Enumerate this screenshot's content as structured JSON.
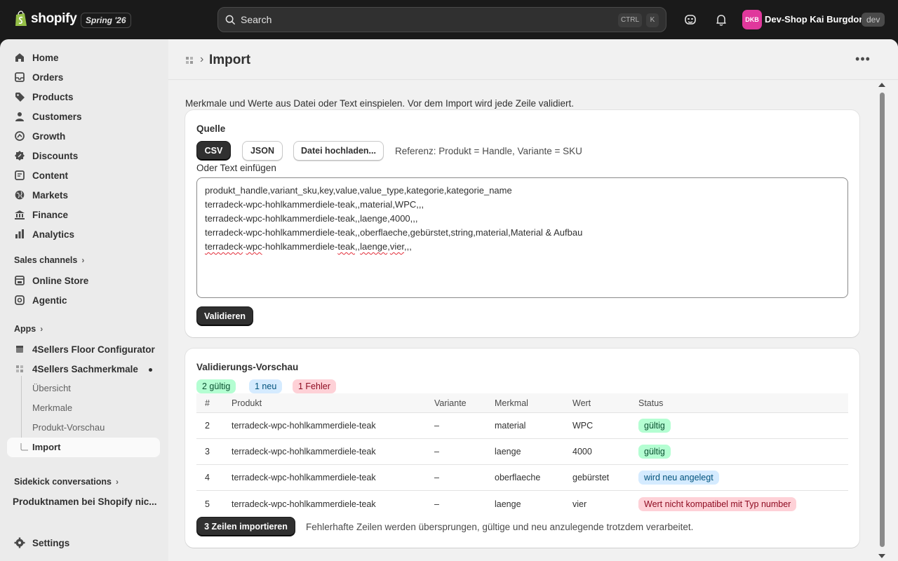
{
  "topbar": {
    "brand": "shopify",
    "edition": "Spring '26",
    "search_placeholder": "Search",
    "kbd_ctrl": "CTRL",
    "kbd_k": "K",
    "avatar_initials": "DKB",
    "shop_name": "Dev-Shop Kai Burgdorf",
    "env_badge": "dev"
  },
  "sidebar": {
    "nav": [
      {
        "label": "Home",
        "icon": "home-icon"
      },
      {
        "label": "Orders",
        "icon": "inbox-icon"
      },
      {
        "label": "Products",
        "icon": "tag-icon"
      },
      {
        "label": "Customers",
        "icon": "person-icon"
      },
      {
        "label": "Growth",
        "icon": "growth-icon"
      },
      {
        "label": "Discounts",
        "icon": "discount-icon"
      },
      {
        "label": "Content",
        "icon": "content-icon"
      },
      {
        "label": "Markets",
        "icon": "globe-icon"
      },
      {
        "label": "Finance",
        "icon": "bank-icon"
      },
      {
        "label": "Analytics",
        "icon": "chart-icon"
      }
    ],
    "sales_channels_label": "Sales channels",
    "channels": [
      {
        "label": "Online Store",
        "icon": "store-icon"
      },
      {
        "label": "Agentic",
        "icon": "agentic-icon"
      }
    ],
    "apps_label": "Apps",
    "apps": [
      {
        "label": "4Sellers Floor Configurator"
      },
      {
        "label": "4Sellers Sachmerkmale"
      }
    ],
    "subitems": [
      "Übersicht",
      "Merkmale",
      "Produkt-Vorschau",
      "Import"
    ],
    "sidekick_label": "Sidekick conversations",
    "conversations": [
      "Produktnamen bei Shopify nic..."
    ],
    "settings_label": "Settings"
  },
  "page": {
    "title": "Import",
    "intro": "Merkmale und Werte aus Datei oder Text einspielen. Vor dem Import wird jede Zeile validiert."
  },
  "source_card": {
    "title": "Quelle",
    "btn_csv": "CSV",
    "btn_json": "JSON",
    "btn_upload": "Datei hochladen...",
    "reference": "Referenz: Produkt = Handle, Variante = SKU",
    "paste_label": "Oder Text einfügen",
    "lines": [
      "produkt_handle,variant_sku,key,value,value_type,kategorie,kategorie_name",
      "terradeck-wpc-hohlkammerdiele-teak,,material,WPC,,,",
      "terradeck-wpc-hohlkammerdiele-teak,,laenge,4000,,,",
      "terradeck-wpc-hohlkammerdiele-teak,,oberflaeche,gebürstet,string,material,Material & Aufbau"
    ],
    "last_line": {
      "p1": "terradeck",
      "p2": "-",
      "p3": "wpc",
      "p4": "-hohlkammerdiele-",
      "p5": "teak",
      "p6": ",,",
      "p7": "laenge",
      "p8": ",",
      "p9": "vier",
      "p10": ",,,"
    },
    "btn_validate": "Validieren"
  },
  "preview_card": {
    "title": "Validierungs-Vorschau",
    "badges": {
      "valid": "2 gültig",
      "new": "1 neu",
      "errors": "1 Fehler"
    },
    "columns": [
      "#",
      "Produkt",
      "Variante",
      "Merkmal",
      "Wert",
      "Status"
    ],
    "rows": [
      {
        "num": "2",
        "product": "terradeck-wpc-hohlkammerdiele-teak",
        "variant": "–",
        "attribute": "material",
        "value": "WPC",
        "status": "gültig",
        "tone": "green"
      },
      {
        "num": "3",
        "product": "terradeck-wpc-hohlkammerdiele-teak",
        "variant": "–",
        "attribute": "laenge",
        "value": "4000",
        "status": "gültig",
        "tone": "green"
      },
      {
        "num": "4",
        "product": "terradeck-wpc-hohlkammerdiele-teak",
        "variant": "–",
        "attribute": "oberflaeche",
        "value": "gebürstet",
        "status": "wird neu angelegt",
        "tone": "blue"
      },
      {
        "num": "5",
        "product": "terradeck-wpc-hohlkammerdiele-teak",
        "variant": "–",
        "attribute": "laenge",
        "value": "vier",
        "status": "Wert nicht kompatibel mit Typ number",
        "tone": "red"
      }
    ],
    "btn_import": "3 Zeilen importieren",
    "import_hint": "Fehlerhafte Zeilen werden übersprungen, gültige und neu anzulegende trotzdem verarbeitet."
  },
  "colors": {
    "accent_dark": "#303030",
    "valid": "#b4fed2",
    "new": "#d5ebff",
    "error": "#fed1d7",
    "avatar": "#e0389c"
  }
}
